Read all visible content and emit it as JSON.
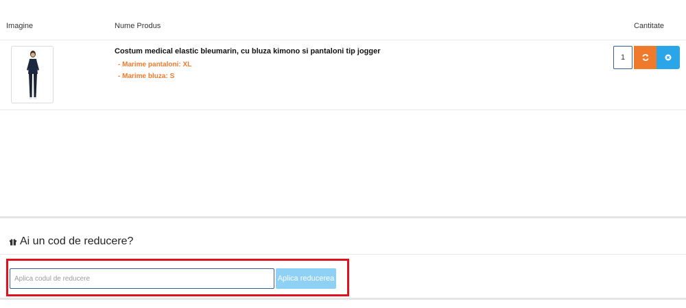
{
  "table": {
    "headers": {
      "image": "Imagine",
      "product_name": "Nume Produs",
      "quantity": "Cantitate"
    },
    "items": [
      {
        "name": "Costum medical elastic bleumarin, cu bluza kimono si pantaloni tip jogger",
        "attributes": [
          "- Marime pantaloni: XL",
          "- Marime bluza: S"
        ],
        "quantity": "1"
      }
    ]
  },
  "discount": {
    "title": "Ai un cod de reducere?",
    "input_placeholder": "Aplica codul de reducere",
    "input_value": "",
    "apply_label": "Aplica reducerea"
  },
  "icons": {
    "refresh": "refresh-icon",
    "remove": "remove-icon",
    "gift": "gift-icon"
  },
  "colors": {
    "accent_orange": "#f07a2b",
    "accent_blue": "#2aa6e8",
    "apply_button": "#8fd0f5",
    "highlight_border": "#e0101d"
  }
}
